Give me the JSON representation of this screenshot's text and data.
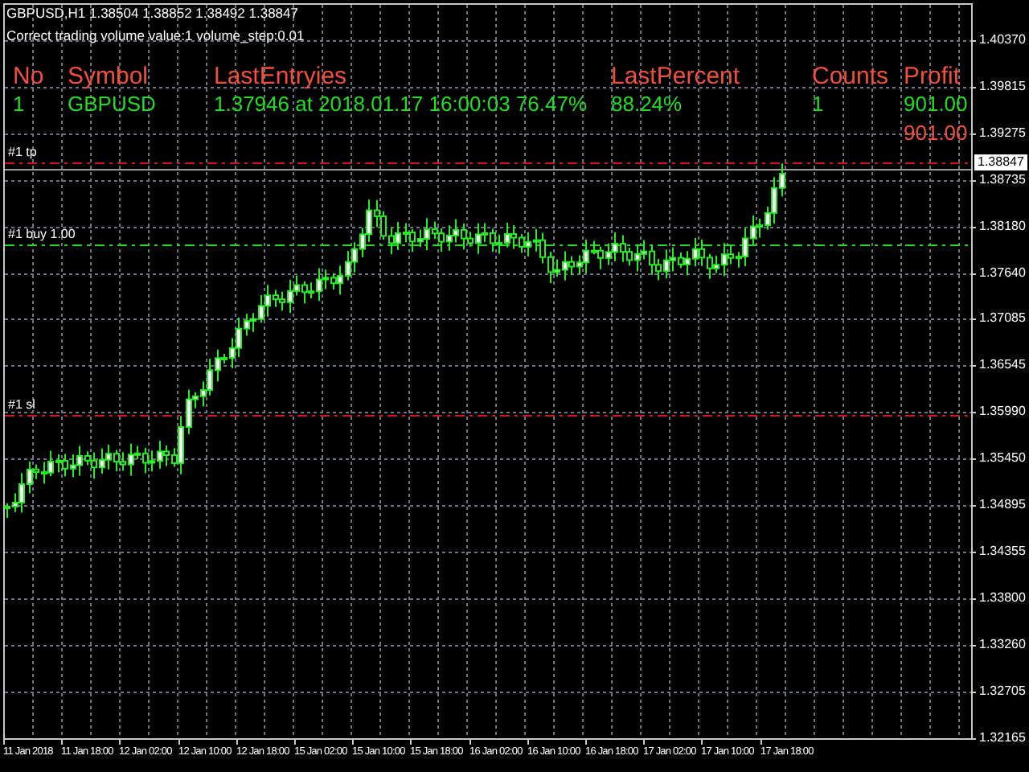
{
  "symbol_info": "GBPUSD,H1  1.38504 1.38852 1.38492 1.38847",
  "message": "Correct trading volume value:1 volume_step:0.01",
  "table": {
    "columns": [
      "No",
      "Symbol",
      "LastEntryies",
      "LastPercent",
      "Counts",
      "Profit"
    ],
    "rows": [
      {
        "cells": [
          "1",
          "GBPUSD",
          "1.37946 at 2018.01.17 16:00:03 76.47%",
          "88.24%",
          "1",
          "901.00"
        ]
      }
    ],
    "total": "901.00"
  },
  "order_lines": [
    {
      "label": "#1 tp",
      "kind": "tp"
    },
    {
      "label": "#1 buy 1.00",
      "kind": "buy"
    },
    {
      "label": "#1 sl",
      "kind": "sl"
    }
  ],
  "current_price": "1.38847",
  "price_axis": [
    "1.40370",
    "1.39815",
    "1.39275",
    "1.38735",
    "1.38180",
    "1.37640",
    "1.37085",
    "1.36545",
    "1.35990",
    "1.35450",
    "1.34895",
    "1.34355",
    "1.33800",
    "1.33260",
    "1.32705",
    "1.32165"
  ],
  "time_axis": [
    "11 Jan 2018",
    "11 Jan 18:00",
    "12 Jan 02:00",
    "12 Jan 10:00",
    "12 Jan 18:00",
    "15 Jan 02:00",
    "15 Jan 10:00",
    "15 Jan 18:00",
    "16 Jan 02:00",
    "16 Jan 10:00",
    "16 Jan 18:00",
    "17 Jan 02:00",
    "17 Jan 10:00",
    "17 Jan 18:00"
  ]
}
